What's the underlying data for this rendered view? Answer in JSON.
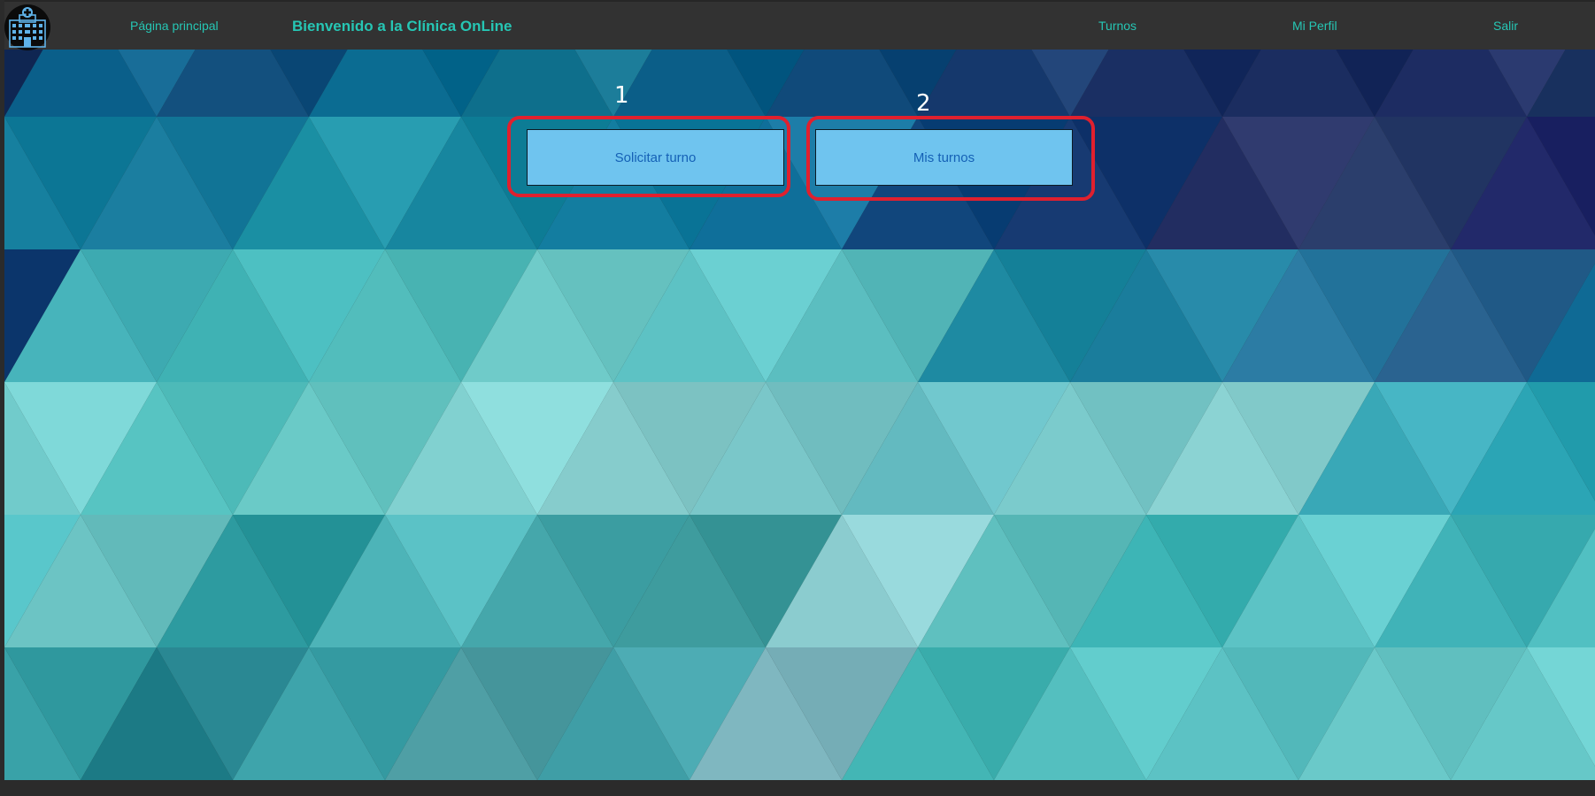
{
  "navbar": {
    "logo_icon": "hospital-building-icon",
    "home_label": "Página principal",
    "title": "Bienvenido a la Clínica OnLine",
    "links": {
      "turnos": "Turnos",
      "perfil": "Mi Perfil",
      "salir": "Salir"
    },
    "accent_color": "#26c6b4",
    "background_color": "#323232"
  },
  "main": {
    "buttons": {
      "solicitar": "Solicitar turno",
      "mis_turnos": "Mis turnos"
    },
    "button_color": "#6fc4ef",
    "button_text_color": "#1561b6"
  },
  "annotations": {
    "first": "1",
    "second": "2",
    "highlight_color": "#e0202e"
  }
}
